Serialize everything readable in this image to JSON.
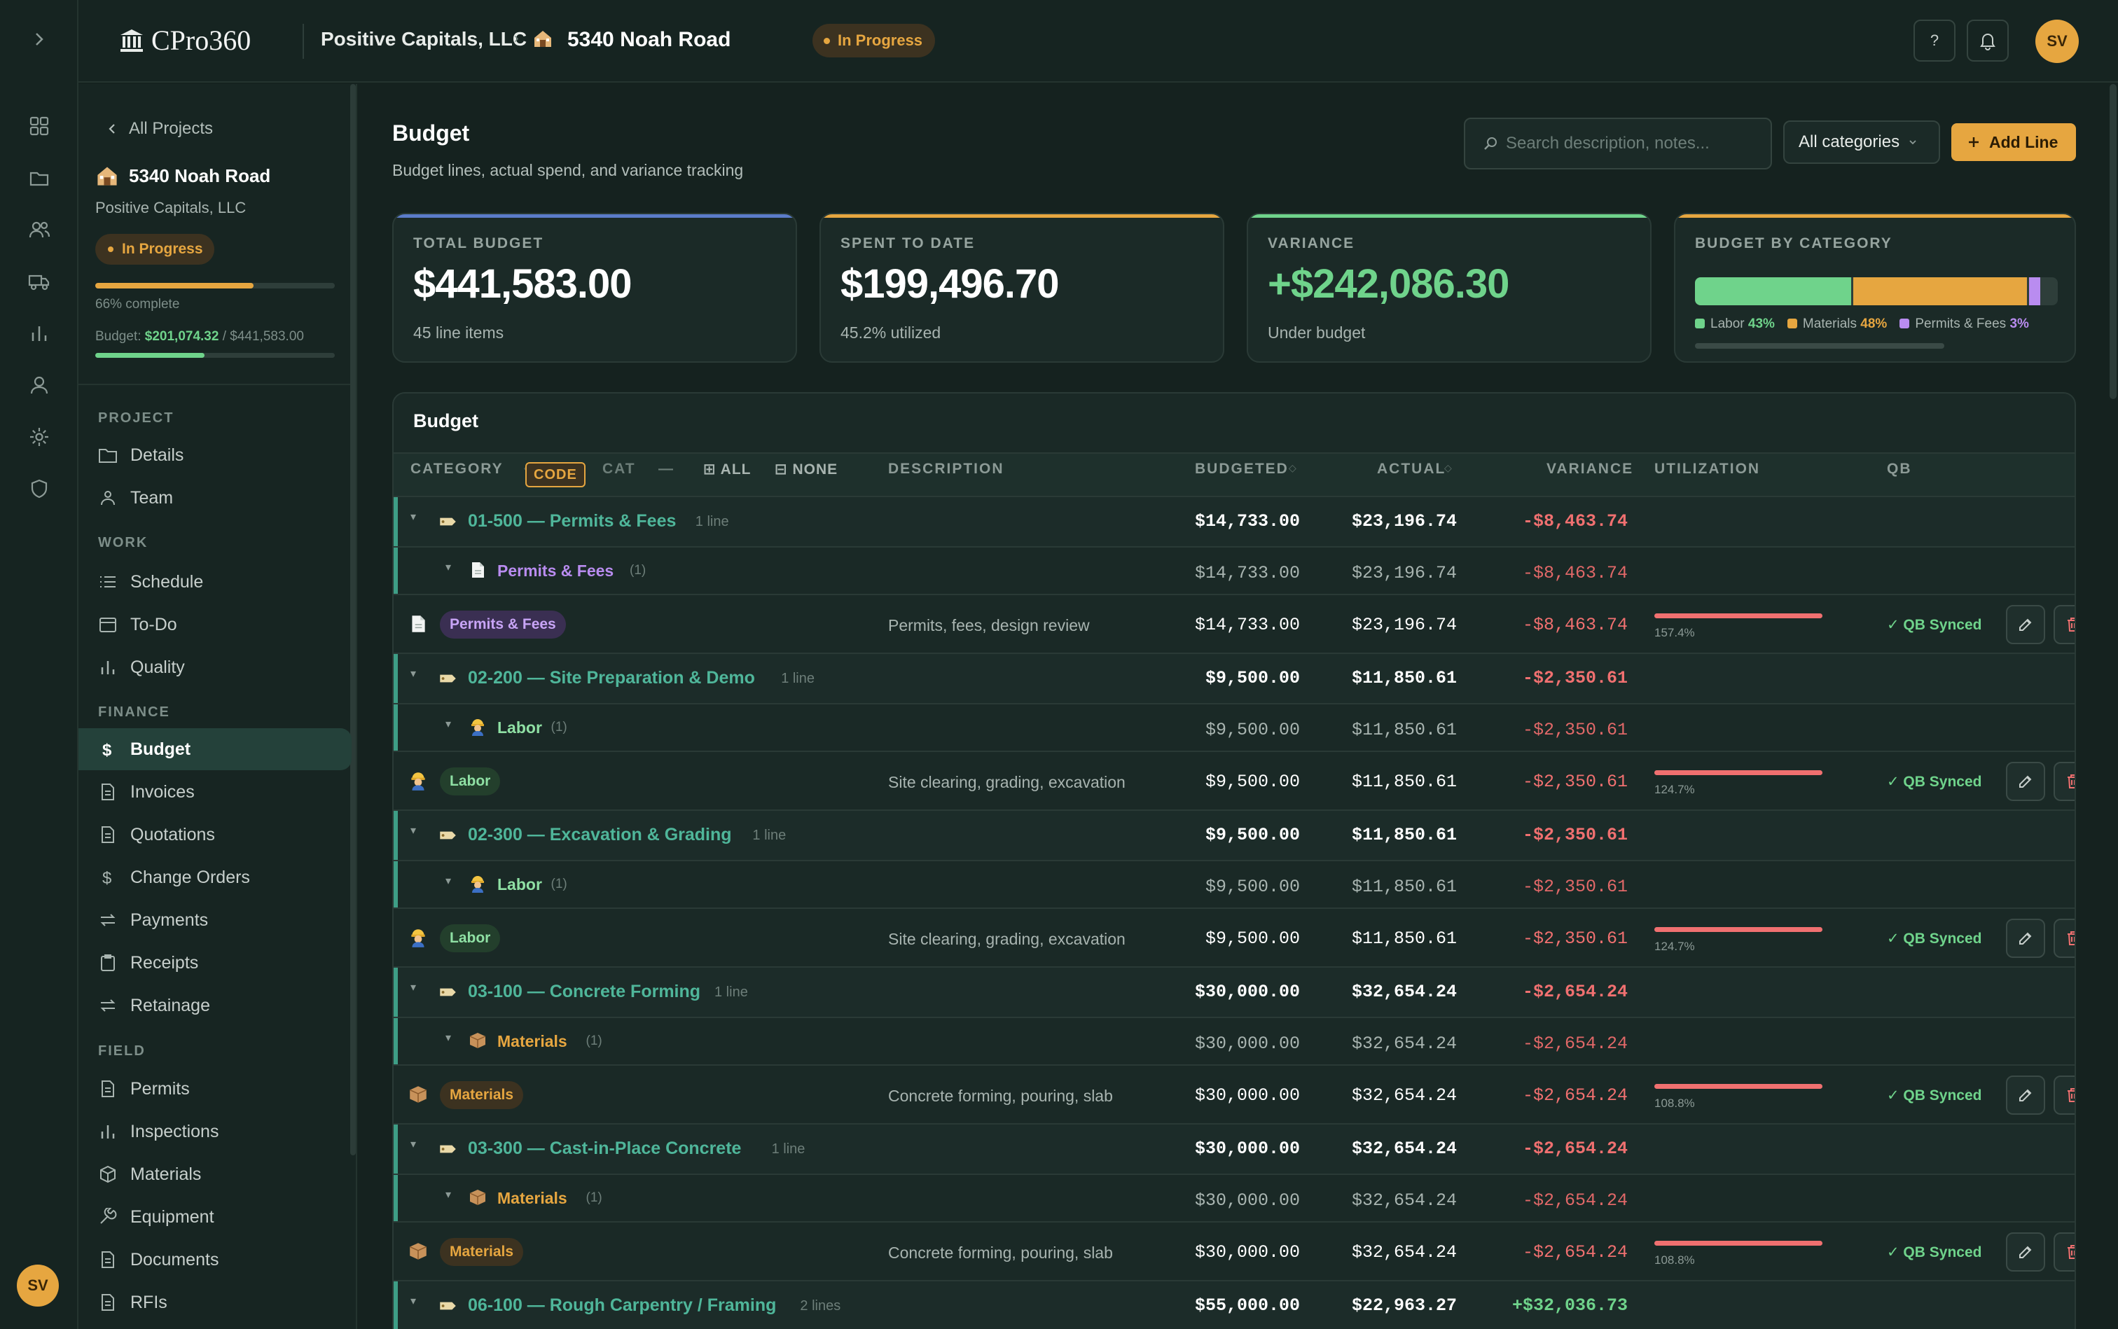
{
  "brand": {
    "name": "CPro360"
  },
  "topbar": {
    "company": "Positive Capitals, LLC",
    "project": "5340 Noah Road",
    "status": "In Progress",
    "help": "?",
    "avatar": "SV"
  },
  "rail": {
    "avatar": "SV",
    "icons": [
      "dashboard-icon",
      "folder-icon",
      "users-icon",
      "truck-icon",
      "chart-icon",
      "person-icon",
      "gear-icon",
      "shield-icon"
    ]
  },
  "sidebar": {
    "back": "All Projects",
    "project_name": "5340 Noah Road",
    "company": "Positive Capitals, LLC",
    "status": "In Progress",
    "progress": 0.66,
    "progress_label": "66% complete",
    "budget_prefix": "Budget:",
    "budget_spent": "$201,074.32",
    "budget_total": "/ $441,583.00",
    "budget_progress": 0.455,
    "sections": [
      {
        "title": "PROJECT",
        "items": [
          "Details",
          "Team"
        ]
      },
      {
        "title": "WORK",
        "items": [
          "Schedule",
          "To-Do",
          "Quality"
        ]
      },
      {
        "title": "FINANCE",
        "items": [
          "Budget",
          "Invoices",
          "Quotations",
          "Change Orders",
          "Payments",
          "Receipts",
          "Retainage"
        ]
      },
      {
        "title": "FIELD",
        "items": [
          "Permits",
          "Inspections",
          "Materials",
          "Equipment",
          "Documents",
          "RFIs"
        ]
      }
    ]
  },
  "page": {
    "title": "Budget",
    "subtitle": "Budget lines, actual spend, and variance tracking",
    "search_placeholder": "Search description, notes...",
    "category_filter": "All categories",
    "add_line": "Add Line"
  },
  "cards": {
    "total": {
      "label": "TOTAL BUDGET",
      "value": "$441,583.00",
      "sub": "45 line items"
    },
    "spent": {
      "label": "SPENT TO DATE",
      "value": "$199,496.70",
      "sub": "45.2% utilized"
    },
    "variance": {
      "label": "VARIANCE",
      "value": "+$242,086.30",
      "sub": "Under budget"
    },
    "category": {
      "label": "BUDGET BY CATEGORY",
      "legend": [
        {
          "name": "Labor",
          "pct": "43%",
          "color": "#6fd38b",
          "share": 0.43
        },
        {
          "name": "Materials",
          "pct": "48%",
          "color": "#e6a640",
          "share": 0.48
        },
        {
          "name": "Permits & Fees",
          "pct": "3%",
          "color": "#b98cf0",
          "share": 0.03
        }
      ]
    }
  },
  "table": {
    "title": "Budget",
    "headers": {
      "category": "CATEGORY",
      "code": "CODE",
      "cat": "CAT",
      "dash": "—",
      "all": "ALL",
      "none": "NONE",
      "description": "DESCRIPTION",
      "budgeted": "BUDGETED",
      "actual": "ACTUAL",
      "variance": "VARIANCE",
      "utilization": "UTILIZATION",
      "qb": "QB"
    },
    "groups": [
      {
        "code": "01-500 — Permits & Fees",
        "lines": "1 line",
        "budgeted": "$14,733.00",
        "actual": "$23,196.74",
        "variance": "-$8,463.74",
        "sub": {
          "name": "Permits & Fees",
          "count": "(1)",
          "kind": "permits"
        },
        "item": {
          "cat": "Permits & Fees",
          "kind": "permits",
          "desc": "Permits, fees, design review",
          "budgeted": "$14,733.00",
          "actual": "$23,196.74",
          "variance": "-$8,463.74",
          "util": "157.4%",
          "util_value": 1.574,
          "qb": "✓ QB Synced"
        }
      },
      {
        "code": "02-200 — Site Preparation & Demo",
        "lines": "1 line",
        "budgeted": "$9,500.00",
        "actual": "$11,850.61",
        "variance": "-$2,350.61",
        "sub": {
          "name": "Labor",
          "count": "(1)",
          "kind": "labor"
        },
        "item": {
          "cat": "Labor",
          "kind": "labor",
          "desc": "Site clearing, grading, excavation",
          "budgeted": "$9,500.00",
          "actual": "$11,850.61",
          "variance": "-$2,350.61",
          "util": "124.7%",
          "util_value": 1.247,
          "qb": "✓ QB Synced"
        }
      },
      {
        "code": "02-300 — Excavation & Grading",
        "lines": "1 line",
        "budgeted": "$9,500.00",
        "actual": "$11,850.61",
        "variance": "-$2,350.61",
        "sub": {
          "name": "Labor",
          "count": "(1)",
          "kind": "labor"
        },
        "item": {
          "cat": "Labor",
          "kind": "labor",
          "desc": "Site clearing, grading, excavation",
          "budgeted": "$9,500.00",
          "actual": "$11,850.61",
          "variance": "-$2,350.61",
          "util": "124.7%",
          "util_value": 1.247,
          "qb": "✓ QB Synced"
        }
      },
      {
        "code": "03-100 — Concrete Forming",
        "lines": "1 line",
        "budgeted": "$30,000.00",
        "actual": "$32,654.24",
        "variance": "-$2,654.24",
        "sub": {
          "name": "Materials",
          "count": "(1)",
          "kind": "materials"
        },
        "item": {
          "cat": "Materials",
          "kind": "materials",
          "desc": "Concrete forming, pouring, slab",
          "budgeted": "$30,000.00",
          "actual": "$32,654.24",
          "variance": "-$2,654.24",
          "util": "108.8%",
          "util_value": 1.088,
          "qb": "✓ QB Synced"
        }
      },
      {
        "code": "03-300 — Cast-in-Place Concrete",
        "lines": "1 line",
        "budgeted": "$30,000.00",
        "actual": "$32,654.24",
        "variance": "-$2,654.24",
        "sub": {
          "name": "Materials",
          "count": "(1)",
          "kind": "materials"
        },
        "item": {
          "cat": "Materials",
          "kind": "materials",
          "desc": "Concrete forming, pouring, slab",
          "budgeted": "$30,000.00",
          "actual": "$32,654.24",
          "variance": "-$2,654.24",
          "util": "108.8%",
          "util_value": 1.088,
          "qb": "✓ QB Synced"
        }
      }
    ],
    "last_group": {
      "code": "06-100 — Rough Carpentry / Framing",
      "lines": "2 lines",
      "budgeted": "$55,000.00",
      "actual": "$22,963.27",
      "variance": "+$32,036.73"
    }
  },
  "colors": {
    "accent": "#e6a640",
    "positive": "#6fd38b",
    "negative": "#f07070",
    "teal": "#3e9e86"
  }
}
